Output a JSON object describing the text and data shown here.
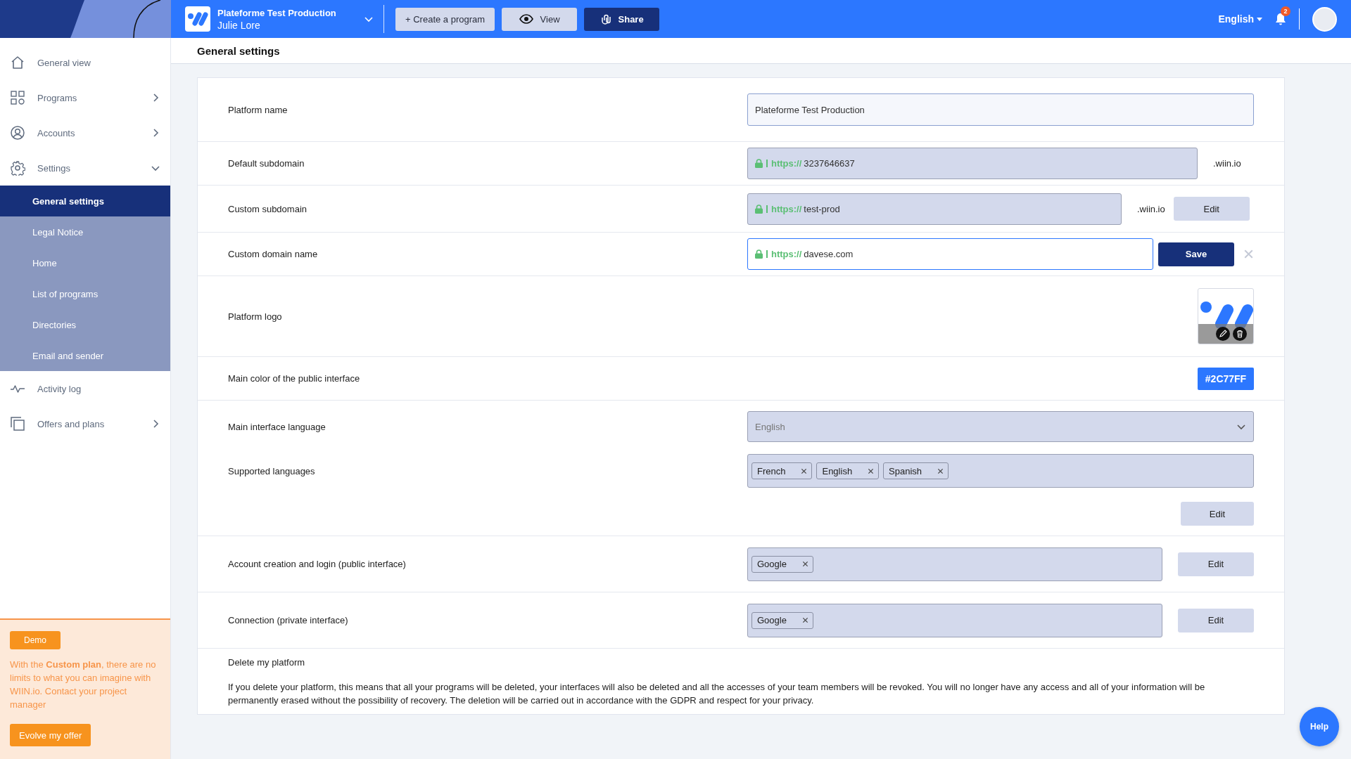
{
  "brand": {
    "platform": "Plateforme Test Production",
    "user": "Julie Lore"
  },
  "topbar": {
    "actions": [
      {
        "label": "+ Create a program",
        "kind": "secondary"
      },
      {
        "label": "View",
        "kind": "view"
      },
      {
        "label": "Share",
        "kind": "primary"
      }
    ],
    "language": "English",
    "notifications": "2"
  },
  "sidebar": {
    "items": [
      {
        "label": "General view"
      },
      {
        "label": "Programs",
        "expanded": false
      },
      {
        "label": "Accounts",
        "expanded": false
      },
      {
        "label": "Settings",
        "expanded": true,
        "children": [
          {
            "label": "General settings",
            "selected": true
          },
          {
            "label": "Legal Notice",
            "selected": false
          },
          {
            "label": "Home",
            "selected": false
          },
          {
            "label": "List of programs",
            "selected": false
          },
          {
            "label": "Directories",
            "selected": false
          },
          {
            "label": "Email and sender",
            "selected": false
          }
        ]
      },
      {
        "label": "Activity log"
      },
      {
        "label": "Offers and plans",
        "expanded": false
      }
    ],
    "promo": {
      "badge": "Demo",
      "text": "With the **Custom plan**, there are no limits to what you can imagine with WIIN.io. Contact your project manager",
      "button": "Evolve my offer"
    }
  },
  "page_title": "General settings",
  "settings": {
    "rows": [
      {
        "kind": "text",
        "label": "Platform name",
        "value": "Plateforme Test Production"
      },
      {
        "kind": "url",
        "label": "Default subdomain",
        "scheme": "https://",
        "value": "3237646637",
        "suffix": ".wiin.io",
        "disabled": true
      },
      {
        "kind": "url",
        "label": "Custom subdomain",
        "scheme": "https://",
        "value": "test-prod",
        "suffix": ".wiin.io",
        "disabled": true,
        "button": {
          "label": "Edit",
          "kind": "secondary"
        }
      },
      {
        "kind": "url",
        "label": "Custom domain name",
        "scheme": "https://",
        "value": "davese.com",
        "disabled": false,
        "button": {
          "label": "Save",
          "kind": "primary"
        },
        "cancel": true
      },
      {
        "kind": "logo",
        "label": "Platform logo"
      },
      {
        "kind": "color",
        "label": "Main color of the public interface",
        "value": "#2C77FF",
        "color": "#2c77ff"
      },
      {
        "kind": "languages",
        "label": "Main interface language",
        "value": "English",
        "tags_label": "Supported languages",
        "tags": [
          "French",
          "English",
          "Spanish"
        ],
        "button": {
          "label": "Edit",
          "kind": "secondary"
        }
      },
      {
        "kind": "tags",
        "label": "Account creation and login (public interface)",
        "tags": [
          "Google"
        ],
        "button": {
          "label": "Edit",
          "kind": "secondary"
        }
      },
      {
        "kind": "tags",
        "label": "Connection (private interface)",
        "tags": [
          "Google"
        ],
        "button": {
          "label": "Edit",
          "kind": "secondary"
        }
      },
      {
        "kind": "note",
        "label": "Delete my platform",
        "text": "If you delete your platform, this means that all your programs will be deleted, your interfaces will also be deleted and all the accesses of your team members will be revoked. You will no longer have any access and all of your information will be permanently erased without the possibility of recovery. The deletion will be carried out in accordance with the GDPR and respect for your privacy."
      }
    ]
  },
  "help_button": "Help"
}
